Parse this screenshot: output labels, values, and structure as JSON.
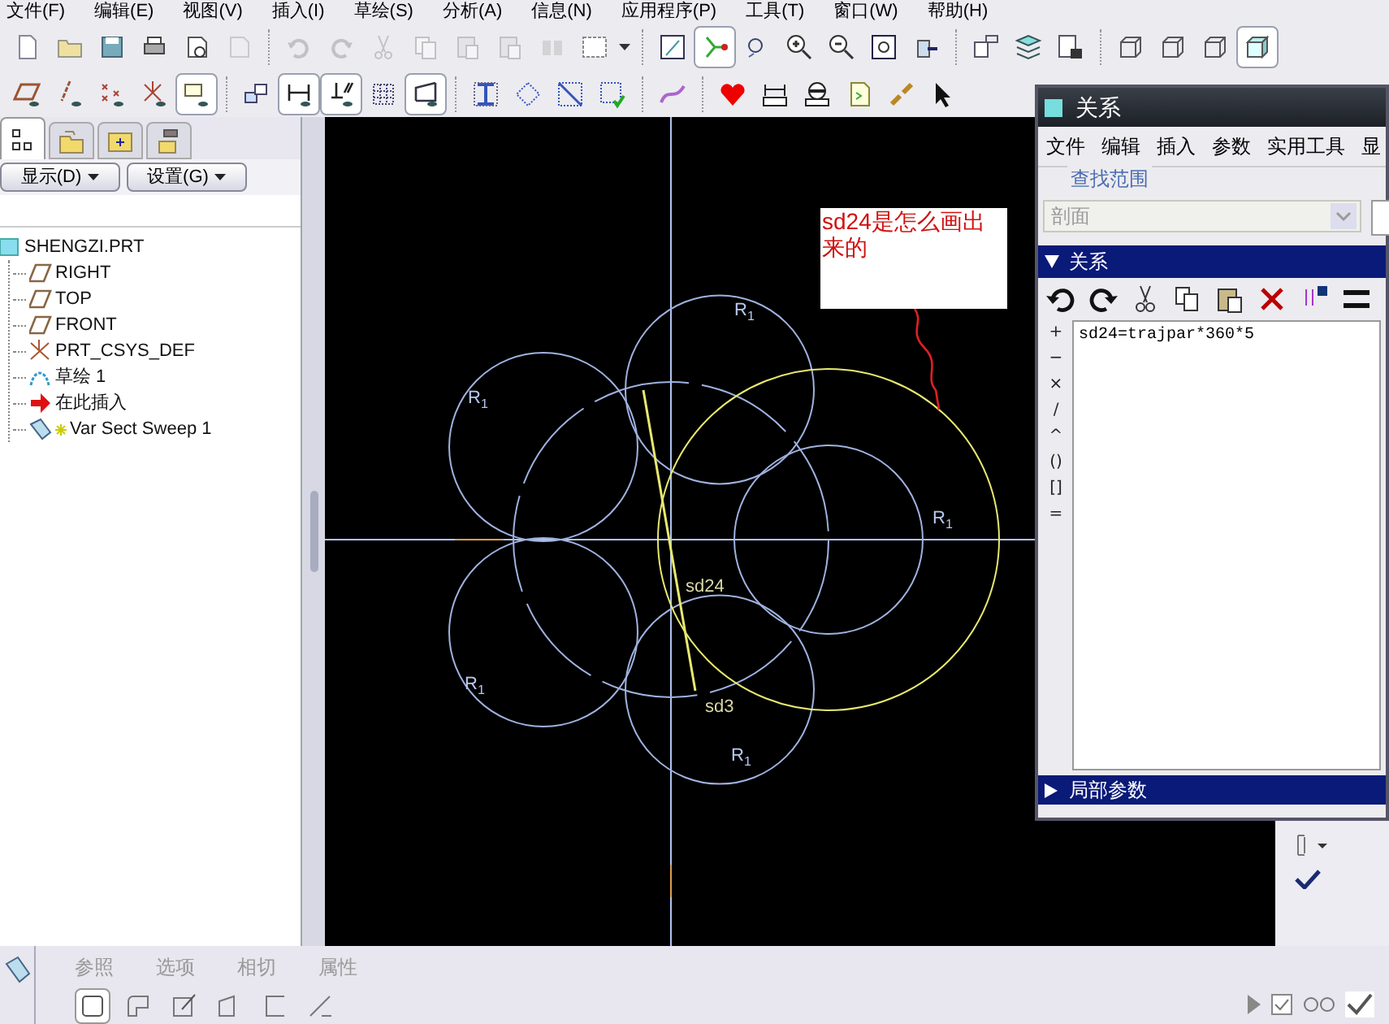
{
  "menu_bar": [
    "文件(F)",
    "编辑(E)",
    "视图(V)",
    "插入(I)",
    "草绘(S)",
    "分析(A)",
    "信息(N)",
    "应用程序(P)",
    "工具(T)",
    "窗口(W)",
    "帮助(H)"
  ],
  "toolbar_rows": [
    [
      [
        {
          "kind": "new",
          "pressed": false,
          "disabled": false
        },
        {
          "kind": "open",
          "pressed": false,
          "disabled": false
        },
        {
          "kind": "save",
          "pressed": false,
          "disabled": false
        },
        {
          "kind": "print",
          "pressed": false,
          "disabled": false
        },
        {
          "kind": "attach",
          "pressed": false,
          "disabled": false
        },
        {
          "kind": "mail",
          "pressed": false,
          "disabled": true
        }
      ],
      [
        {
          "kind": "undo",
          "pressed": false,
          "disabled": true
        },
        {
          "kind": "redo",
          "pressed": false,
          "disabled": true
        },
        {
          "kind": "cut",
          "pressed": false,
          "disabled": true
        },
        {
          "kind": "copy",
          "pressed": false,
          "disabled": true
        },
        {
          "kind": "paste",
          "pressed": false,
          "disabled": true
        },
        {
          "kind": "paste",
          "pressed": false,
          "disabled": true
        },
        {
          "kind": "binoculars",
          "pressed": false,
          "disabled": true
        },
        {
          "kind": "selectbox",
          "pressed": false,
          "disabled": false
        }
      ],
      [
        {
          "kind": "sketchview",
          "pressed": false,
          "disabled": false
        },
        {
          "kind": "node",
          "pressed": true,
          "disabled": false
        },
        {
          "kind": "regen",
          "pressed": false,
          "disabled": false
        },
        {
          "kind": "zoomin",
          "pressed": false,
          "disabled": false
        },
        {
          "kind": "zoomout",
          "pressed": false,
          "disabled": false
        },
        {
          "kind": "zoomfit",
          "pressed": false,
          "disabled": false
        },
        {
          "kind": "orient",
          "pressed": false,
          "disabled": false
        }
      ],
      [
        {
          "kind": "annot",
          "pressed": false,
          "disabled": false
        },
        {
          "kind": "layers",
          "pressed": false,
          "disabled": false
        },
        {
          "kind": "table",
          "pressed": false,
          "disabled": false
        }
      ],
      [
        {
          "kind": "wire",
          "pressed": false,
          "disabled": false
        },
        {
          "kind": "wire",
          "pressed": false,
          "disabled": false
        },
        {
          "kind": "wire",
          "pressed": false,
          "disabled": false
        },
        {
          "kind": "shaded",
          "pressed": true,
          "disabled": false
        }
      ]
    ],
    [
      [
        {
          "kind": "plane",
          "pressed": false,
          "disabled": false
        },
        {
          "kind": "axis",
          "pressed": false,
          "disabled": false
        },
        {
          "kind": "points",
          "pressed": false,
          "disabled": false
        },
        {
          "kind": "csys",
          "pressed": false,
          "disabled": false
        },
        {
          "kind": "boxz",
          "pressed": true,
          "disabled": false
        }
      ],
      [
        {
          "kind": "stack",
          "pressed": false,
          "disabled": false
        },
        {
          "kind": "dim",
          "pressed": true,
          "disabled": false
        },
        {
          "kind": "perp",
          "pressed": true,
          "disabled": false
        },
        {
          "kind": "grid",
          "pressed": false,
          "disabled": false
        },
        {
          "kind": "line",
          "pressed": true,
          "disabled": false
        }
      ],
      [
        {
          "kind": "ibeam",
          "pressed": false,
          "disabled": false
        },
        {
          "kind": "dashrot",
          "pressed": false,
          "disabled": false
        },
        {
          "kind": "dashcross",
          "pressed": false,
          "disabled": false
        },
        {
          "kind": "dashcheck",
          "pressed": false,
          "disabled": false
        }
      ],
      [
        {
          "kind": "curve",
          "pressed": false,
          "disabled": false
        }
      ],
      [
        {
          "kind": "heart",
          "pressed": false,
          "disabled": false
        },
        {
          "kind": "ruler",
          "pressed": false,
          "disabled": false
        },
        {
          "kind": "gauge",
          "pressed": false,
          "disabled": false
        },
        {
          "kind": "sheet",
          "pressed": false,
          "disabled": false
        },
        {
          "kind": "chain",
          "pressed": false,
          "disabled": false
        },
        {
          "kind": "cursor",
          "pressed": false,
          "disabled": false
        }
      ]
    ]
  ],
  "navigator_tabs": [
    {
      "kind": "tree",
      "selected": true
    },
    {
      "kind": "folders",
      "selected": false
    },
    {
      "kind": "favorites",
      "selected": false
    },
    {
      "kind": "tools",
      "selected": false
    }
  ],
  "navigator_buttons": [
    "显示(D)",
    "设置(G)"
  ],
  "model_tree": {
    "label": "SHENGZI.PRT",
    "children": [
      {
        "label": "RIGHT",
        "kind": "plane"
      },
      {
        "label": "TOP",
        "kind": "plane"
      },
      {
        "label": "FRONT",
        "kind": "plane"
      },
      {
        "label": "PRT_CSYS_DEF",
        "kind": "csys"
      },
      {
        "label": "草绘 1",
        "kind": "sketch"
      },
      {
        "label": "在此插入",
        "kind": "insert"
      },
      {
        "label": "Var Sect Sweep 1",
        "kind": "sweep"
      }
    ]
  },
  "sketch": {
    "dimension_labels": [
      "R$_{1}$",
      "R$_{1}$",
      "R$_{1}$",
      "R$_{1}$",
      "R$_{1}$",
      "sd24",
      "sd3"
    ]
  },
  "annotation": {
    "text": "sd24是怎么画出来的"
  },
  "relations_dialog": {
    "title": "关系",
    "menu": [
      "文件",
      "编辑",
      "插入",
      "参数",
      "实用工具",
      "显"
    ],
    "lookup_group": {
      "title": "查找范围",
      "dropdown": {
        "value": "剖面",
        "disabled": true
      }
    },
    "relations_section": {
      "title": "关系",
      "expanded": true,
      "operators": [
        "+",
        "−",
        "×",
        "/",
        "^",
        "()",
        "[]",
        "="
      ],
      "text": "sd24=trajpar*360*5"
    },
    "local_params_section": {
      "title": "局部参数",
      "expanded": false
    }
  },
  "dashboard": {
    "tabs": [
      {
        "label": "参照",
        "disabled": true
      },
      {
        "label": "选项",
        "disabled": true
      },
      {
        "label": "相切",
        "disabled": true
      },
      {
        "label": "属性",
        "disabled": true
      }
    ],
    "tools": [
      {
        "kind": "rect",
        "pressed": true
      },
      {
        "kind": "roundrect",
        "pressed": false
      },
      {
        "kind": "edit",
        "pressed": false
      },
      {
        "kind": "skew",
        "pressed": false
      },
      {
        "kind": "bracket",
        "pressed": false
      },
      {
        "kind": "slash",
        "pressed": false
      }
    ]
  }
}
